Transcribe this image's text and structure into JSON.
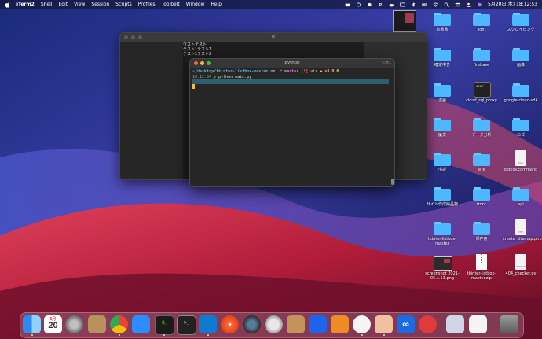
{
  "menubar": {
    "app": "iTerm2",
    "items": [
      "Shell",
      "Edit",
      "View",
      "Session",
      "Scripts",
      "Profiles",
      "Toolbelt",
      "Window",
      "Help"
    ],
    "clock": "5月20日(木) 18:12:53"
  },
  "back_window": {
    "title": "tk",
    "lines": [
      "ウストテスト",
      "テスト1テスト1",
      "テスト2テスト2"
    ]
  },
  "terminal": {
    "title": "python",
    "shortcut": "⌥⌘1",
    "prompt_path": "~/desktop/tkinter-listbox-master",
    "prompt_on": "on",
    "branch_icon": "branch-icon",
    "branch": "master",
    "git_status": "[!]",
    "prompt_via": "via",
    "python_icon": "python-icon",
    "python_version": "v3.9.0",
    "time": "18:12:34",
    "command": "python main.py"
  },
  "desktop_icons": [
    {
      "label": "読書書",
      "type": "folder"
    },
    {
      "label": "light",
      "type": "folder"
    },
    {
      "label": "スクレイピング",
      "type": "folder"
    },
    {
      "label": "確定申告",
      "type": "folder"
    },
    {
      "label": "firebase",
      "type": "folder"
    },
    {
      "label": "画像",
      "type": "folder"
    },
    {
      "label": "漫画",
      "type": "folder"
    },
    {
      "label": "cloud_sql_proxy",
      "type": "terminal"
    },
    {
      "label": "google-cloud-sdk",
      "type": "folder"
    },
    {
      "label": "論文",
      "type": "folder"
    },
    {
      "label": "データ分析",
      "type": "folder"
    },
    {
      "label": "ロゴ",
      "type": "folder"
    },
    {
      "label": "小説",
      "type": "folder"
    },
    {
      "label": "site",
      "type": "folder"
    },
    {
      "label": "deploy.command",
      "type": "doc",
      "badge": "exec"
    },
    {
      "label": "サイト作成納品物",
      "type": "folder"
    },
    {
      "label": "front",
      "type": "folder"
    },
    {
      "label": "api",
      "type": "folder"
    },
    {
      "label": "tkinter-listbox-master",
      "type": "folder"
    },
    {
      "label": "保存用",
      "type": "folder"
    },
    {
      "label": "create_sitemap.php",
      "type": "doc",
      "badge": "PHP"
    },
    {
      "label": "screenshot 2021-05....53.png",
      "type": "screenshot"
    },
    {
      "label": "tkinter-listbox-master.zip",
      "type": "zip"
    },
    {
      "label": "404_checker.py",
      "type": "doc",
      "badge": "PYTHON"
    }
  ],
  "dock": {
    "calendar_month": "5月",
    "calendar_day": "20",
    "apps": [
      "finder-icon",
      "calendar-icon",
      "system-preferences-icon",
      "notes-icon",
      "chrome-icon",
      "zoom-icon",
      "iterm-icon",
      "terminal-icon",
      "vscode-icon",
      "safari-icon",
      "quicktime-icon",
      "sequel-icon",
      "archive-icon",
      "docker-icon",
      "sourcetree-icon",
      "app-icon",
      "preview-icon",
      "infinity-icon",
      "clock-icon",
      "photos-icon",
      "document-icon",
      "trash-icon"
    ]
  }
}
